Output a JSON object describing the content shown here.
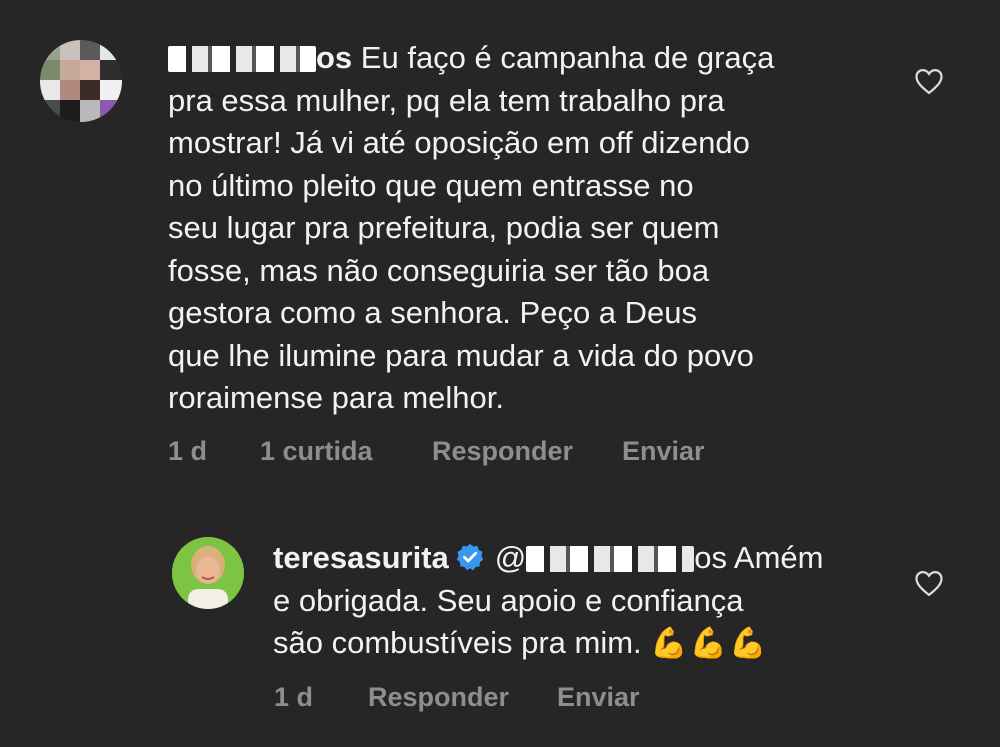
{
  "comment1": {
    "username_suffix": "os",
    "text": " Eu faço é campanha de graça\npra essa mulher, pq ela tem trabalho pra\nmostrar! Já vi até oposição em off dizendo\nno último pleito que quem entrasse no\nseu lugar pra prefeitura, podia ser quem\nfosse, mas não conseguiria ser tão boa\ngestora como a senhora. Peço a Deus\nque lhe ilumine para mudar a vida do povo\nroraimense para melhor.",
    "time": "1 d",
    "likes": "1 curtida",
    "reply": "Responder",
    "send": "Enviar",
    "like_icon": "heart-outline-icon"
  },
  "comment2": {
    "username": "teresasurita",
    "mention_prefix": "@",
    "mention_suffix": "os",
    "text": " Amém\ne obrigada. Seu apoio e confiança\nsão combustíveis pra mim. ",
    "emoji": "💪💪💪",
    "time": "1 d",
    "reply": "Responder",
    "send": "Enviar",
    "verified_icon": "verified-badge-icon",
    "verified_color": "#3897f0",
    "like_icon": "heart-outline-icon"
  }
}
